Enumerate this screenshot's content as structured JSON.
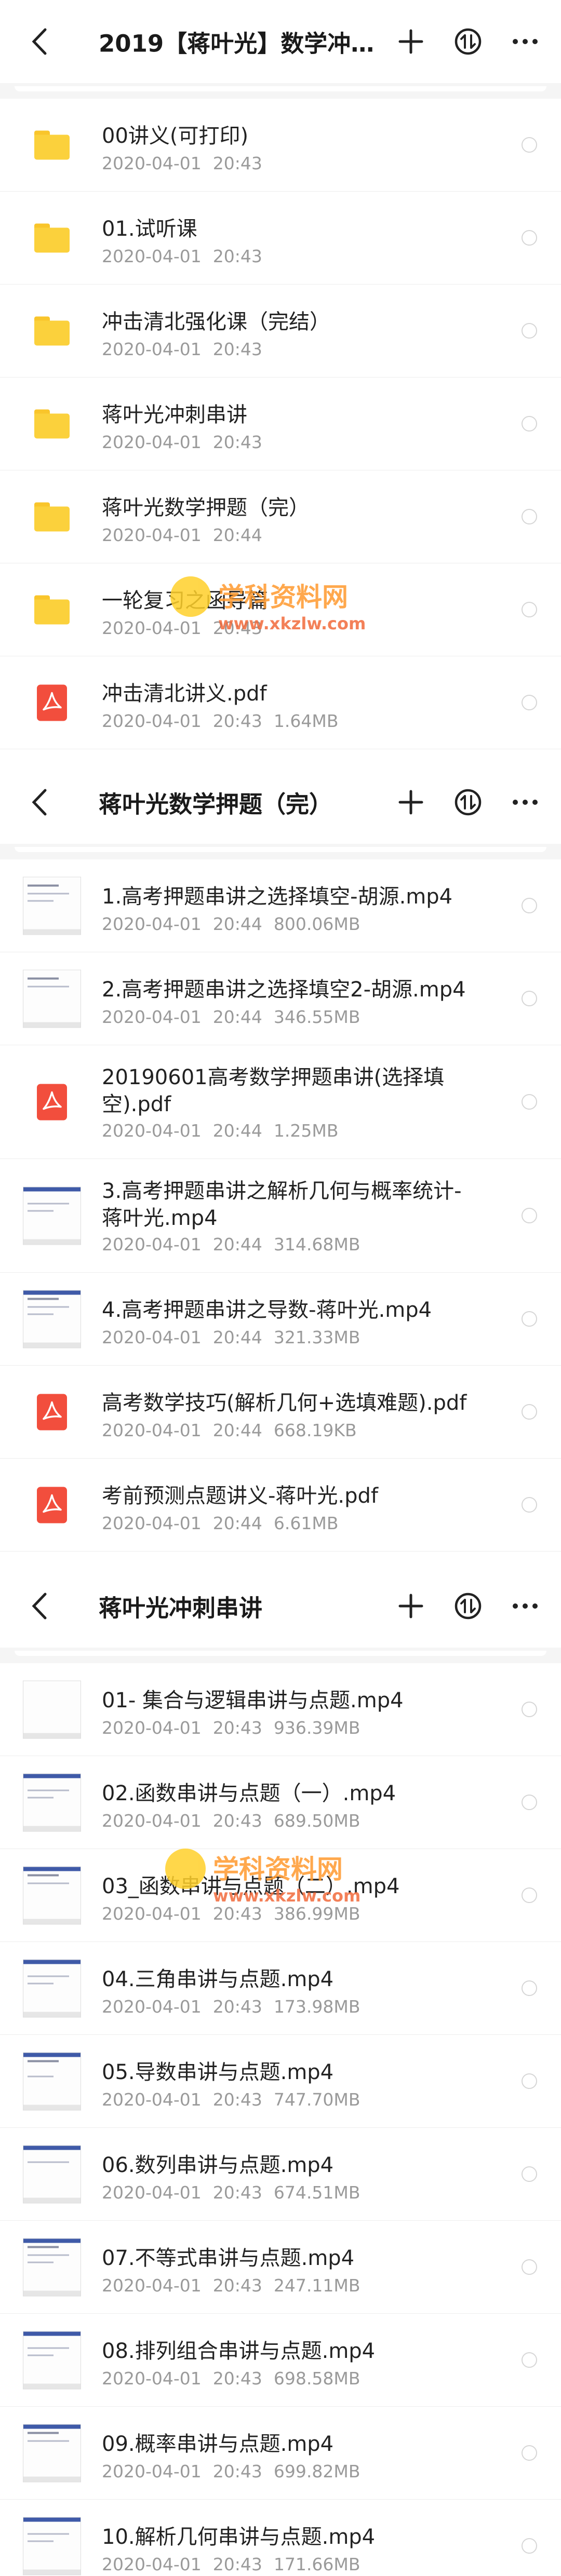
{
  "panels": [
    {
      "title": "2019【蒋叶光】数学冲…",
      "items": [
        {
          "type": "folder",
          "name": "00讲义(可打印)",
          "date": "2020-04-01",
          "time": "20:43",
          "size": ""
        },
        {
          "type": "folder",
          "name": "01.试听课",
          "date": "2020-04-01",
          "time": "20:43",
          "size": ""
        },
        {
          "type": "folder",
          "name": "冲击清北强化课（完结）",
          "date": "2020-04-01",
          "time": "20:43",
          "size": ""
        },
        {
          "type": "folder",
          "name": "蒋叶光冲刺串讲",
          "date": "2020-04-01",
          "time": "20:43",
          "size": ""
        },
        {
          "type": "folder",
          "name": "蒋叶光数学押题（完）",
          "date": "2020-04-01",
          "time": "20:44",
          "size": ""
        },
        {
          "type": "folder",
          "name": "一轮复习之函导篇",
          "date": "2020-04-01",
          "time": "20:43",
          "size": ""
        },
        {
          "type": "pdf",
          "name": "冲击清北讲义.pdf",
          "date": "2020-04-01",
          "time": "20:43",
          "size": "1.64MB"
        }
      ]
    },
    {
      "title": "蒋叶光数学押题（完）",
      "items": [
        {
          "type": "video",
          "name": "1.高考押题串讲之选择填空-胡源.mp4",
          "date": "2020-04-01",
          "time": "20:44",
          "size": "800.06MB"
        },
        {
          "type": "video",
          "name": "2.高考押题串讲之选择填空2-胡源.mp4",
          "date": "2020-04-01",
          "time": "20:44",
          "size": "346.55MB"
        },
        {
          "type": "pdf",
          "name": "20190601高考数学押题串讲(选择填空).pdf",
          "date": "2020-04-01",
          "time": "20:44",
          "size": "1.25MB"
        },
        {
          "type": "video",
          "name": "3.高考押题串讲之解析几何与概率统计-蒋叶光.mp4",
          "date": "2020-04-01",
          "time": "20:44",
          "size": "314.68MB"
        },
        {
          "type": "video",
          "name": "4.高考押题串讲之导数-蒋叶光.mp4",
          "date": "2020-04-01",
          "time": "20:44",
          "size": "321.33MB"
        },
        {
          "type": "pdf",
          "name": "高考数学技巧(解析几何+选填难题).pdf",
          "date": "2020-04-01",
          "time": "20:44",
          "size": "668.19KB"
        },
        {
          "type": "pdf",
          "name": "考前预测点题讲义-蒋叶光.pdf",
          "date": "2020-04-01",
          "time": "20:44",
          "size": "6.61MB"
        }
      ]
    },
    {
      "title": "蒋叶光冲刺串讲",
      "items": [
        {
          "type": "video",
          "name": "01- 集合与逻辑串讲与点题.mp4",
          "date": "2020-04-01",
          "time": "20:43",
          "size": "936.39MB"
        },
        {
          "type": "video",
          "name": "02.函数串讲与点题（一）.mp4",
          "date": "2020-04-01",
          "time": "20:43",
          "size": "689.50MB"
        },
        {
          "type": "video",
          "name": "03_函数串讲与点题（二）.mp4",
          "date": "2020-04-01",
          "time": "20:43",
          "size": "386.99MB"
        },
        {
          "type": "video",
          "name": "04.三角串讲与点题.mp4",
          "date": "2020-04-01",
          "time": "20:43",
          "size": "173.98MB"
        },
        {
          "type": "video",
          "name": "05.导数串讲与点题.mp4",
          "date": "2020-04-01",
          "time": "20:43",
          "size": "747.70MB"
        },
        {
          "type": "video",
          "name": "06.数列串讲与点题.mp4",
          "date": "2020-04-01",
          "time": "20:43",
          "size": "674.51MB"
        },
        {
          "type": "video",
          "name": "07.不等式串讲与点题.mp4",
          "date": "2020-04-01",
          "time": "20:43",
          "size": "247.11MB"
        },
        {
          "type": "video",
          "name": "08.排列组合串讲与点题.mp4",
          "date": "2020-04-01",
          "time": "20:43",
          "size": "698.58MB"
        },
        {
          "type": "video",
          "name": "09.概率串讲与点题.mp4",
          "date": "2020-04-01",
          "time": "20:43",
          "size": "699.82MB"
        },
        {
          "type": "video",
          "name": "10.解析几何串讲与点题.mp4",
          "date": "2020-04-01",
          "time": "20:43",
          "size": "171.66MB"
        }
      ]
    }
  ],
  "watermark": {
    "text": "学科资料网",
    "url": "www.xkzlw.com"
  },
  "colors": {
    "folder": "#fbd13c",
    "pdf": "#f24e3d",
    "text": "#222222",
    "meta": "#9a9a9a"
  }
}
